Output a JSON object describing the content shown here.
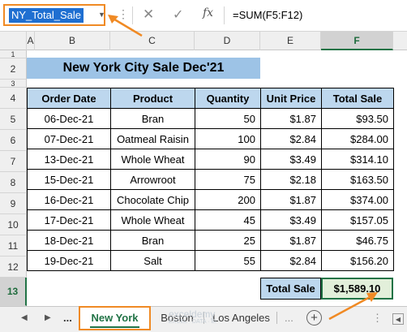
{
  "formula_bar": {
    "name_box": "NY_Total_Sale",
    "formula": "=SUM(F5:F12)",
    "fx_label": "fx"
  },
  "columns": [
    "A",
    "B",
    "C",
    "D",
    "E",
    "F"
  ],
  "rows": [
    "1",
    "2",
    "3",
    "4",
    "5",
    "6",
    "7",
    "8",
    "9",
    "10",
    "11",
    "12",
    "13"
  ],
  "sheet": {
    "title": "New York City Sale Dec'21",
    "headers": [
      "Order Date",
      "Product",
      "Quantity",
      "Unit Price",
      "Total Sale"
    ],
    "records": [
      [
        "06-Dec-21",
        "Bran",
        "50",
        "$1.87",
        "$93.50"
      ],
      [
        "07-Dec-21",
        "Oatmeal Raisin",
        "100",
        "$2.84",
        "$284.00"
      ],
      [
        "13-Dec-21",
        "Whole Wheat",
        "90",
        "$3.49",
        "$314.10"
      ],
      [
        "15-Dec-21",
        "Arrowroot",
        "75",
        "$2.18",
        "$163.50"
      ],
      [
        "16-Dec-21",
        "Chocolate Chip",
        "200",
        "$1.87",
        "$374.00"
      ],
      [
        "17-Dec-21",
        "Whole Wheat",
        "45",
        "$3.49",
        "$157.05"
      ],
      [
        "18-Dec-21",
        "Bran",
        "25",
        "$1.87",
        "$46.75"
      ],
      [
        "19-Dec-21",
        "Salt",
        "55",
        "$2.84",
        "$156.20"
      ]
    ],
    "total_label": "Total Sale",
    "total_value": "$1,589.10"
  },
  "tabs": {
    "more": "...",
    "active": "New York",
    "others": [
      "Boston",
      "Los Angeles"
    ],
    "more_right": "...",
    "add": "+"
  },
  "watermark": {
    "name": "exceldemy",
    "tagline": "EXCEL · DATA · BI"
  },
  "colors": {
    "accent_orange": "#f08a24",
    "excel_green": "#217346",
    "title_fill": "#9dc3e6",
    "header_fill": "#bdd7ee",
    "selection_blue": "#1f6fd1"
  }
}
